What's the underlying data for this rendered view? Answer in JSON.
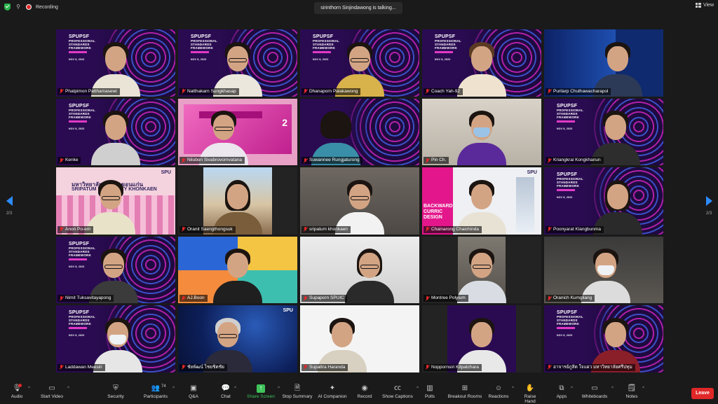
{
  "top_bar": {
    "recording_label": "Recording",
    "speaking_banner": "sirinthorn Sinjindawong is talking...",
    "view_label": "View"
  },
  "pagination": {
    "left": "2/3",
    "right": "2/3"
  },
  "banner": {
    "line1": "SPUPSF",
    "line2": "PROFESSIONAL",
    "line3": "STANDARDS",
    "line4": "FRAMEWORK",
    "date": "NOV 8, 2023"
  },
  "slide_number": "2",
  "uni_slide": {
    "title": "มหาวิทยาลัยศรีปทุม ขอนแก่น",
    "subtitle": "SRIPATUM UNIVERSITY KHONKAEN"
  },
  "book_slide": {
    "text": "BACKWARD CURRIC DESIGN"
  },
  "spu_logo": "SPU",
  "participants": [
    {
      "name": "Phatpimon Patthamasewi"
    },
    {
      "name": "Natthakarn Sungkhasap"
    },
    {
      "name": "Dhanaporn Palakawong"
    },
    {
      "name": "Coach Yah-92"
    },
    {
      "name": "Purilarp Chuthawacharapol"
    },
    {
      "name": "Kenke"
    },
    {
      "name": "Nilubon Sivabrovornvatana"
    },
    {
      "name": "Suwannee Rungjaturong"
    },
    {
      "name": "Pin Ch."
    },
    {
      "name": "Kriangkrai Kongkhanun"
    },
    {
      "name": "Anon Po-em"
    },
    {
      "name": "Oranit Saengthongsuk"
    },
    {
      "name": "sripatum khonkaen"
    },
    {
      "name": "Chainarong Chaichinda"
    },
    {
      "name": "Poonyarat Klangbunma"
    },
    {
      "name": "Nimit Tuksavitayapong"
    },
    {
      "name": "AJ.Boon"
    },
    {
      "name": "Supaporn SPUIC"
    },
    {
      "name": "Montree Polyium"
    },
    {
      "name": "Oranich Kumgliang"
    },
    {
      "name": "Laddawan Meesiri"
    },
    {
      "name": "ชัยพัฒน์ ไชยชิตชัย"
    },
    {
      "name": "Supattra Haranda"
    },
    {
      "name": "Noppornsiri Kitpatchara"
    },
    {
      "name": "อาจารย์ภูสิต ใจแผ่ว มหาวิทยาลัยศรีปทุม"
    }
  ],
  "toolbar": {
    "audio": "Audio",
    "start_video": "Start Video",
    "security": "Security",
    "participants": "Participants",
    "participants_count": "74",
    "qa": "Q&A",
    "chat": "Chat",
    "share_screen": "Share Screen",
    "stop_summary": "Stop Summary",
    "ai_companion": "AI Companion",
    "record": "Record",
    "show_captions": "Show Captions",
    "polls": "Polls",
    "breakout_rooms": "Breakout Rooms",
    "reactions": "Reactions",
    "raise_hand": "Raise Hand",
    "apps": "Apps",
    "whiteboards": "Whiteboards",
    "notes": "Notes",
    "leave": "Leave"
  },
  "colors": {
    "accent": "#2d8cff",
    "leave": "#e02828",
    "share_green": "#3ec35a",
    "banner_purple": "#2a0b52",
    "banner_pink": "#e03ac5"
  }
}
